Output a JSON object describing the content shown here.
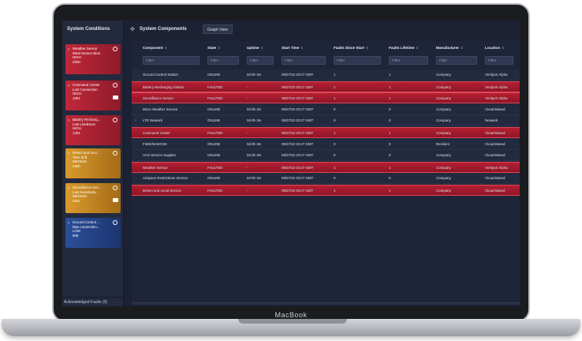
{
  "device": {
    "brand": "MacBook"
  },
  "sidebar": {
    "title": "System Conditions",
    "cards": [
      {
        "title": "Weather Sensor",
        "desc": "Wind Sensor Bias",
        "severity": "HIGH",
        "code": "2000",
        "level": "high",
        "camera": false
      },
      {
        "title": "Command Center",
        "desc": "Lost Connection",
        "severity": "HIGH",
        "code": "1001",
        "level": "high",
        "camera": true
      },
      {
        "title": "Battery Recharg...",
        "desc": "Lost Liveliness",
        "severity": "HIGH",
        "code": "1401",
        "level": "high",
        "camera": false
      },
      {
        "title": "Detect and Avoi...",
        "desc": "Time drift",
        "severity": "MEDIUM",
        "code": "2300",
        "level": "medium",
        "camera": false
      },
      {
        "title": "Surveillance Sen...",
        "desc": "Lost Sensitivity...",
        "severity": "MEDIUM",
        "code": "2021",
        "level": "medium",
        "camera": true
      },
      {
        "title": "Ground Control ...",
        "desc": "Max connection...",
        "severity": "LOW",
        "code": "808",
        "level": "low",
        "camera": false
      }
    ],
    "acknowledged": "Acknowledged Faults (0)"
  },
  "header": {
    "title": "System Components",
    "graph_button": "Graph View"
  },
  "table": {
    "columns": [
      "Component",
      "State",
      "Uptime",
      "Start Time",
      "Faults Since Start",
      "Faults Lifetime",
      "Manufacturer",
      "Location"
    ],
    "filter_placeholder": "Filter",
    "rows": [
      [
        "Ground Control Station",
        "ONLINE",
        "0d 0h 3m",
        "09/27/22 03:27 GMT",
        "1",
        "1",
        "Company",
        "Vertiport Alpha"
      ],
      [
        "Battery Recharging Station",
        "FAULTED",
        "-",
        "09/27/22 03:27 GMT",
        "1",
        "1",
        "Company",
        "Vertiport Alpha"
      ],
      [
        "Surveillance Sensor",
        "FAULTED",
        "-",
        "09/27/22 03:27 GMT",
        "1",
        "1",
        "Company",
        "Vertiport Alpha"
      ],
      [
        "Micro Weather Service",
        "ONLINE",
        "0d 0h 3m",
        "09/27/22 03:27 GMT",
        "0",
        "0",
        "Company",
        "Cloud-Based"
      ],
      [
        "LTE Network",
        "ONLINE",
        "0d 0h 3m",
        "09/27/22 03:27 GMT",
        "0",
        "0",
        "Company",
        "Network"
      ],
      [
        "Command Center",
        "FAULTED",
        "-",
        "09/27/22 03:27 GMT",
        "1",
        "1",
        "Company",
        "Cloud-Based"
      ],
      [
        "FIMS/NAWCNK",
        "ONLINE",
        "0d 0h 3m",
        "09/27/22 03:27 GMT",
        "0",
        "0",
        "Resilient",
        "Cloud-Based"
      ],
      [
        "UAS Service Supplier",
        "ONLINE",
        "0d 0h 3m",
        "09/27/22 03:27 GMT",
        "0",
        "0",
        "Company",
        "Cloud-Based"
      ],
      [
        "Weather Sensor",
        "FAULTED",
        "-",
        "09/27/22 03:27 GMT",
        "1",
        "1",
        "Company",
        "Vertiport Alpha"
      ],
      [
        "Airspace Restrictions Service",
        "ONLINE",
        "0d 0h 3m",
        "09/27/22 03:27 GMT",
        "0",
        "0",
        "Company",
        "Cloud-Based"
      ],
      [
        "Detect and Avoid Service",
        "FAULTED",
        "-",
        "09/27/22 03:27 GMT",
        "1",
        "1",
        "Company",
        "Cloud-Based"
      ]
    ],
    "expandable_row": 4
  },
  "colors": {
    "background": "#1c2134",
    "faulted_row": "#b51f33",
    "high": "#c1283a",
    "medium": "#d99a2b",
    "low": "#2b4f9a"
  }
}
